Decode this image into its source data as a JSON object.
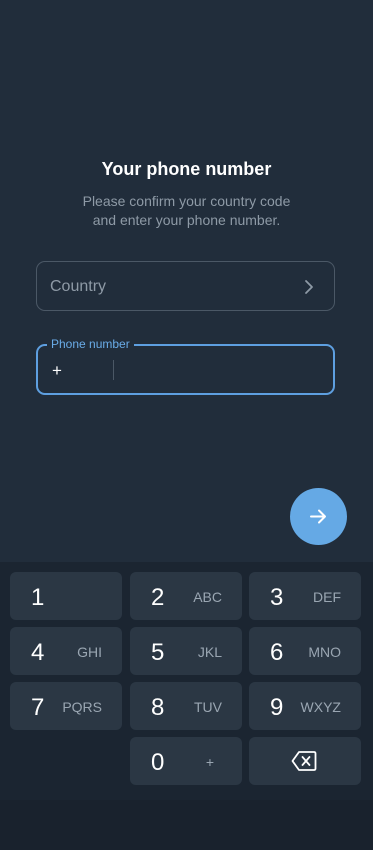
{
  "header": {
    "title": "Your phone number",
    "subtitle_line1": "Please confirm your country code",
    "subtitle_line2": "and enter your phone number."
  },
  "country_field": {
    "placeholder": "Country",
    "icon": "chevron-right-icon"
  },
  "phone_field": {
    "label": "Phone number",
    "prefix": "+",
    "value": ""
  },
  "next_button": {
    "icon": "arrow-right-icon",
    "color": "#65a9e5"
  },
  "keypad": {
    "keys": [
      {
        "digit": "1",
        "letters": ""
      },
      {
        "digit": "2",
        "letters": "ABC"
      },
      {
        "digit": "3",
        "letters": "DEF"
      },
      {
        "digit": "4",
        "letters": "GHI"
      },
      {
        "digit": "5",
        "letters": "JKL"
      },
      {
        "digit": "6",
        "letters": "MNO"
      },
      {
        "digit": "7",
        "letters": "PQRS"
      },
      {
        "digit": "8",
        "letters": "TUV"
      },
      {
        "digit": "9",
        "letters": "WXYZ"
      },
      {
        "digit": "0",
        "letters": "+"
      }
    ],
    "backspace_icon": "backspace-icon"
  },
  "colors": {
    "background": "#212d3b",
    "accent": "#5e9fe0",
    "key_background": "#2b3744"
  }
}
